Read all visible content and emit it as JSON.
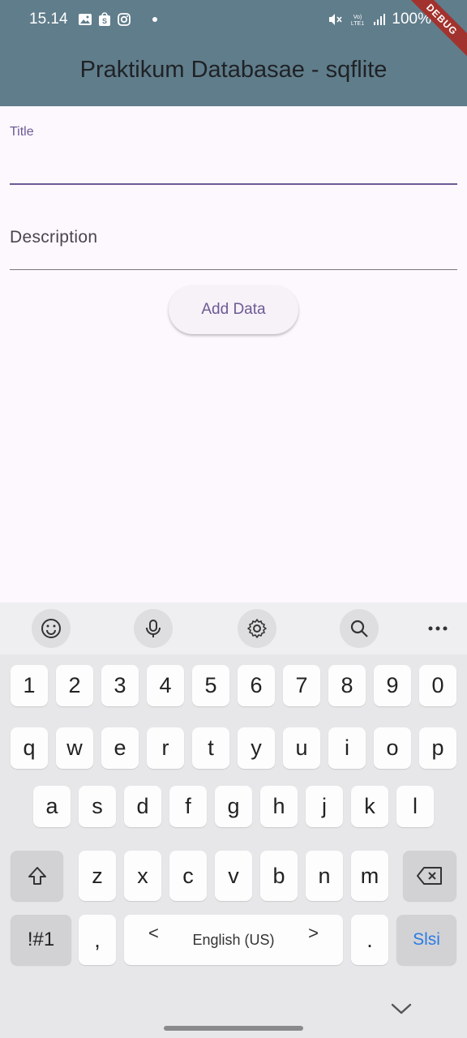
{
  "status_bar": {
    "time": "15.14",
    "battery": "100%",
    "network_label": "Vo) LTE1"
  },
  "app_bar": {
    "title": "Praktikum Databasae - sqflite",
    "debug_banner": "DEBUG",
    "color": "#607d8b"
  },
  "form": {
    "title_label": "Title",
    "title_value": "",
    "description_label": "Description",
    "description_value": "",
    "add_button_label": "Add Data",
    "accent": "#6b5b95"
  },
  "keyboard": {
    "toolbar_icons": [
      "emoji-icon",
      "microphone-icon",
      "settings-icon",
      "search-icon",
      "more-icon"
    ],
    "number_row": [
      "1",
      "2",
      "3",
      "4",
      "5",
      "6",
      "7",
      "8",
      "9",
      "0"
    ],
    "row1": [
      "q",
      "w",
      "e",
      "r",
      "t",
      "y",
      "u",
      "i",
      "o",
      "p"
    ],
    "row2": [
      "a",
      "s",
      "d",
      "f",
      "g",
      "h",
      "j",
      "k",
      "l"
    ],
    "row3": [
      "z",
      "x",
      "c",
      "v",
      "b",
      "n",
      "m"
    ],
    "symbols_key": "!#1",
    "comma_key": ",",
    "space_label": "English (US)",
    "space_left": "<",
    "space_right": ">",
    "period_key": ".",
    "action_key": "Slsi",
    "action_color": "#2a7be4"
  }
}
